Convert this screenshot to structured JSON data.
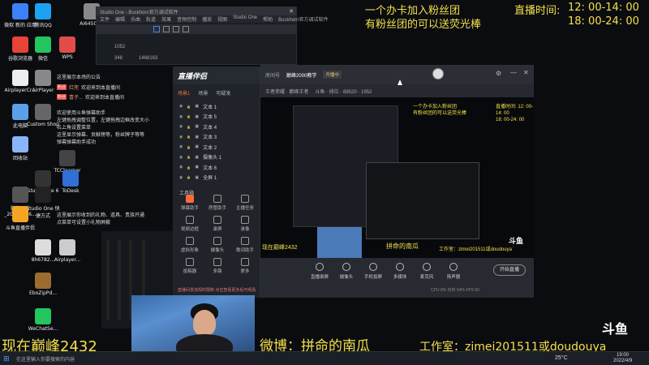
{
  "overlay": {
    "line1": "一个办卡加入粉丝团",
    "line2": "有粉丝团的可以送荧光棒",
    "time_label": "直播时间:",
    "time1": "12: 00-14: 00",
    "time2": "18: 00-24: 00",
    "bottom_left": "现在巅峰2432",
    "weibo": "微博：拼命的南瓜",
    "studio": "工作室：zimei201511或doudouya"
  },
  "desktop_icons": [
    {
      "label": "微软 新的 应用",
      "color": "#3b82f6"
    },
    {
      "label": "腾讯QQ",
      "color": "#1da1f2"
    },
    {
      "label": "Ai6450(1)",
      "color": "#888"
    },
    {
      "label": "谷歌浏览器",
      "color": "#e94335"
    },
    {
      "label": "微信",
      "color": "#22c55e"
    },
    {
      "label": "WPS",
      "color": "#e24b4b"
    },
    {
      "label": "AirplayerCr...",
      "color": "#eee"
    },
    {
      "label": "AirPlayer",
      "color": "#888"
    },
    {
      "label": "此电脑",
      "color": "#5aa0e8"
    },
    {
      "label": "Custom Shop",
      "color": "#666"
    },
    {
      "label": "回收站",
      "color": "#8ab4f8"
    },
    {
      "label": "TCClearner",
      "color": "#444"
    },
    {
      "label": "Studio One 6",
      "color": "#333"
    },
    {
      "label": "Studio One 快捷方式",
      "color": "#222"
    },
    {
      "label": "ToDesk",
      "color": "#2f6fd6"
    },
    {
      "label": "微信图片_20220406...",
      "color": "#555"
    },
    {
      "label": "斗鱼直播伴侣",
      "color": "#f5a524"
    },
    {
      "label": "8h6782...",
      "color": "#ddd"
    },
    {
      "label": "Airplayer...",
      "color": "#ccc"
    },
    {
      "label": "EboZipPd...",
      "color": "#9c6b2f"
    },
    {
      "label": "WeChatSe...",
      "color": "#22c55e"
    }
  ],
  "bg_window": {
    "title": "Studio One - Buckhorn官方调试软件",
    "menu": [
      "文件",
      "编辑",
      "乐曲",
      "轨道",
      "效果",
      "音频控制",
      "播放",
      "视图",
      "Studio One",
      "帮助",
      "Buckhorn官方调试软件"
    ],
    "stats": [
      "1052",
      "348",
      "1468163"
    ]
  },
  "chat": [
    {
      "text": "这里展示本场的公告"
    },
    {
      "name": "红兜",
      "badge": "粉丝",
      "msg": "欢迎来到本直播间"
    },
    {
      "name": "喜子...",
      "badge": "粉丝",
      "msg": "欢迎来到本直播间"
    }
  ],
  "chat_notes": [
    "欢迎使用斗鱼弹幕助手",
    "左键拖拽调整位置，左键拖拽边框改变大小",
    "右上角设置菜单",
    "这里显示弹幕、贡献榜等，粉丝牌子等等",
    "弹幕弹幕助手成功"
  ],
  "gift_notes": [
    "这里展示你收到的礼物、道具、贵族开通",
    "点菜单可设置小礼物屏蔽"
  ],
  "panel": {
    "tabs": [
      "场景1",
      "场景",
      "可疑发"
    ],
    "sources": [
      "文本 1",
      "文本 5",
      "文本 4",
      "文本 3",
      "文本 2",
      "摄像头 1",
      "文本 6",
      "全屏 1"
    ],
    "toolbox_label": "工具箱",
    "tools": [
      "弹幕助手",
      "房管助手",
      "主播任务",
      "视频边框",
      "录屏",
      "录像",
      "虚拟形象",
      "摄像头",
      "歌词助手",
      "投稿器",
      "多路",
      "更多"
    ],
    "notice": "直播间发违规的限制 点击查看更多后可观看"
  },
  "app": {
    "brand": "直播伴侣",
    "room_label": "房间号",
    "room": "巅峰2000教学",
    "status": "开播中",
    "title": "王者荣耀 · 巅峰王者",
    "meta": "斗鱼 · 排位 · 88520 · 1952",
    "preview_texts": [
      "拼命的南瓜",
      "工作室：zimei201511或doudouya",
      "现在巅峰2432"
    ],
    "bottom_buttons": [
      "直播录屏",
      "摄像头",
      "手机投屏",
      "多媒体",
      "麦克风",
      "扬声器"
    ],
    "start_button": "开始直播",
    "stats": "CPU 8%   内存 54%   FPS 60",
    "date": "2022/4/9"
  },
  "taskbar": {
    "search": "在这里输入你要搜索的内容",
    "weather": "25°C",
    "time": "19:00",
    "date": "2022/4/9"
  },
  "logo": "斗鱼"
}
